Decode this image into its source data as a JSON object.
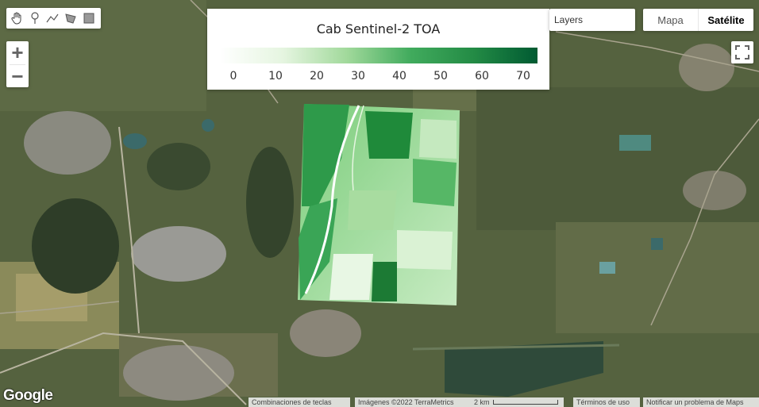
{
  "toolbar": {
    "tools": [
      "hand-icon",
      "marker-icon",
      "line-icon",
      "polygon-icon",
      "rectangle-icon"
    ]
  },
  "zoom": {
    "in_label": "+",
    "out_label": "−"
  },
  "legend": {
    "title": "Cab Sentinel-2 TOA",
    "ticks": [
      "0",
      "10",
      "20",
      "30",
      "40",
      "50",
      "60",
      "70"
    ],
    "colors": [
      "#ffffff",
      "#e5f5e0",
      "#a1d99b",
      "#41ab5d",
      "#238b45",
      "#005a32"
    ]
  },
  "layers": {
    "label": "Layers"
  },
  "maptype": {
    "map_label": "Mapa",
    "satellite_label": "Satélite"
  },
  "footer": {
    "logo": "Google",
    "shortcuts": "Combinaciones de teclas",
    "imagery": "Imágenes ©2022 TerraMetrics",
    "scale": "2 km",
    "terms": "Términos de uso",
    "report": "Notificar un problema de Maps"
  }
}
